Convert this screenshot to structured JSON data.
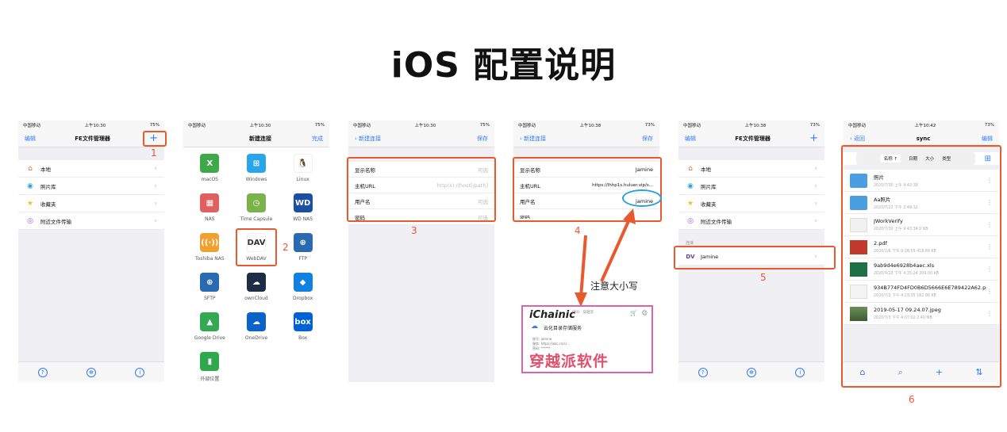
{
  "page_title": "iOS 配置说明",
  "colors": {
    "accent": "#2f7cf6",
    "highlight": "#e8592e",
    "annotation": "#e8592e"
  },
  "status_bar": {
    "carrier": "中国移动",
    "time_a": "上午10:30",
    "time_b": "上午10:38",
    "time_c": "上午10:42",
    "battery_a": "75%",
    "battery_b": "73%"
  },
  "phone1": {
    "edit": "编辑",
    "title": "FE文件管理器",
    "add": "+",
    "items": [
      {
        "icon": "house-icon",
        "label": "本地"
      },
      {
        "icon": "photos-icon",
        "label": "照片库"
      },
      {
        "icon": "star-icon",
        "label": "收藏夹"
      },
      {
        "icon": "airdrop-icon",
        "label": "附近文件传输"
      }
    ],
    "step": "1"
  },
  "phone2": {
    "title": "新建连接",
    "done": "完成",
    "services": [
      {
        "label": "macOS",
        "glyph": "X",
        "color": "#3fa84a"
      },
      {
        "label": "Windows",
        "glyph": "⊞",
        "color": "#2aa6e8"
      },
      {
        "label": "Linux",
        "glyph": "🐧",
        "color": "#ffffff"
      },
      {
        "label": "NAS",
        "glyph": "▦",
        "color": "#e06060"
      },
      {
        "label": "Time Capsule",
        "glyph": "◷",
        "color": "#7bb249"
      },
      {
        "label": "WD NAS",
        "glyph": "WD",
        "color": "#1b4fa0"
      },
      {
        "label": "Toshiba NAS",
        "glyph": "((·))",
        "color": "#f0a030"
      },
      {
        "label": "WebDAV",
        "glyph": "DAV",
        "color": "#ffffff"
      },
      {
        "label": "FTP",
        "glyph": "⊕",
        "color": "#2a6ab0"
      },
      {
        "label": "SFTP",
        "glyph": "⊕",
        "color": "#2a6ab0"
      },
      {
        "label": "ownCloud",
        "glyph": "☁",
        "color": "#1d2d44"
      },
      {
        "label": "Dropbox",
        "glyph": "◆",
        "color": "#1081de"
      },
      {
        "label": "Google Drive",
        "glyph": "▲",
        "color": "#34a853"
      },
      {
        "label": "OneDrive",
        "glyph": "☁",
        "color": "#0a63c9"
      },
      {
        "label": "Box",
        "glyph": "box",
        "color": "#0061d5"
      },
      {
        "label": "外部位置",
        "glyph": "▮",
        "color": "#2fa84f"
      }
    ],
    "step": "2"
  },
  "phone3": {
    "back": "新建连接",
    "save": "保存",
    "fields": [
      {
        "key": "显示名称",
        "value": "可选"
      },
      {
        "key": "主机URL",
        "value": "http(s)://host[/path]"
      },
      {
        "key": "用户名",
        "value": "可选"
      },
      {
        "key": "密码",
        "value": "可选"
      }
    ],
    "step": "3"
  },
  "phone4": {
    "back": "新建连接",
    "save": "保存",
    "fields": [
      {
        "key": "显示名称",
        "value": "Jamine"
      },
      {
        "key": "主机URL",
        "value": "https://lhhp1s.huluer.vip/s..."
      },
      {
        "key": "用户名",
        "value": "jamine"
      },
      {
        "key": "密码",
        "value": ""
      }
    ],
    "step": "4",
    "case_note": "注意大小写",
    "card": {
      "logo": "iChainic",
      "sub": "PRO · 穿越云",
      "service": "云化目录存储服务",
      "lines": [
        "账号: jamine",
        "服务: https://abc.cn/s/...",
        "密码: ******"
      ],
      "banner": "穿越派软件"
    }
  },
  "phone5": {
    "edit": "编辑",
    "title": "FE文件管理器",
    "add": "+",
    "items": [
      {
        "icon": "house-icon",
        "label": "本地"
      },
      {
        "icon": "photos-icon",
        "label": "照片库"
      },
      {
        "icon": "star-icon",
        "label": "收藏夹"
      },
      {
        "icon": "airdrop-icon",
        "label": "附近文件传输"
      }
    ],
    "section": "连接",
    "connection": "Jamine",
    "step": "5"
  },
  "phone6": {
    "back": "返回",
    "title": "sync",
    "edit": "编辑",
    "sort": [
      "名称 ↑",
      "日期",
      "大小",
      "类型"
    ],
    "files": [
      {
        "name": "照片",
        "date": "2020/7/30 上午 9:42:39",
        "kind": "folder"
      },
      {
        "name": "Aa照片",
        "date": "2020/7/23 下午 2:49:12",
        "kind": "folder"
      },
      {
        "name": "JWorkVerify",
        "date": "2020/7/30 上午 9:43:34  0 KB",
        "kind": "doc"
      },
      {
        "name": "2.pdf",
        "date": "2020/2/6 下午 9:28:55  418.69 KB",
        "kind": "pdf"
      },
      {
        "name": "9ab9d4e6928b4aec.xls",
        "date": "2020/4/23 下午 4:35:24  309.00 KB",
        "kind": "xls"
      },
      {
        "name": "934B774FD4FD0B6D5666E6E789422A62.png",
        "date": "2020/7/2 下午 4:23:35  162.86 KB",
        "kind": "png"
      },
      {
        "name": "2019-05-17 09.24.07.jpeg",
        "date": "2020/7/3 下午 4:07:02  2.40 MB",
        "kind": "jpg"
      }
    ],
    "step": "6"
  }
}
